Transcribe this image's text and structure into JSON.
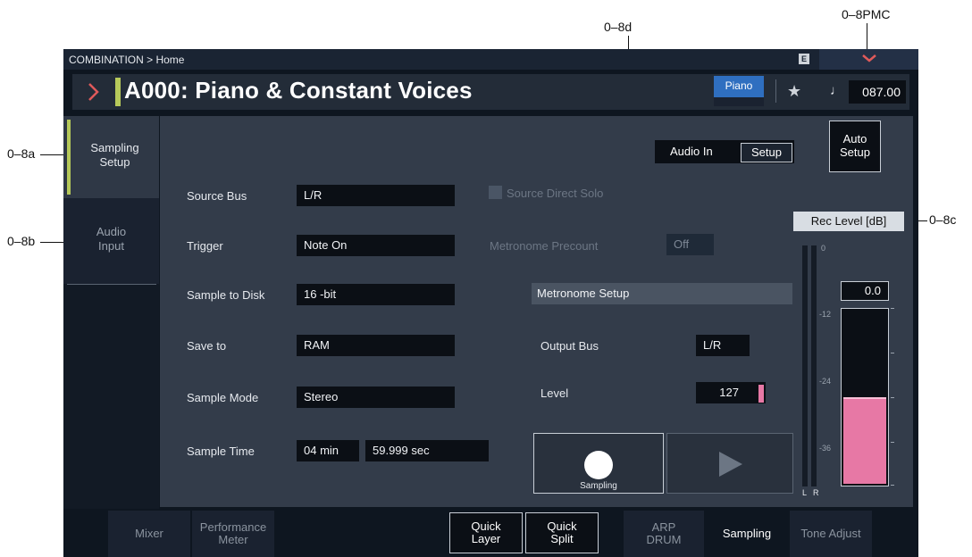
{
  "callouts": {
    "a": "0–8a",
    "b": "0–8b",
    "c": "0–8c",
    "d": "0–8d",
    "pmc": "0–8PMC"
  },
  "topbar": {
    "breadcrumb": "COMBINATION > Home",
    "badge": "E",
    "dropdown_icon": "chevron-down-icon"
  },
  "title": {
    "program_name": "A000: Piano & Constant Voices",
    "category": "Piano",
    "tempo": "087.00",
    "favorite_icon": "star-icon",
    "tempo_icon": "note-icon"
  },
  "side_tabs": {
    "sampling_setup": "Sampling Setup",
    "audio_input": "Audio Input"
  },
  "main": {
    "audio_in_label": "Audio In",
    "setup_button": "Setup",
    "auto_setup_button": "Auto Setup",
    "source_bus_label": "Source Bus",
    "source_bus_value": "L/R",
    "source_direct_solo_label": "Source Direct Solo",
    "trigger_label": "Trigger",
    "trigger_value": "Note On",
    "metronome_precount_label": "Metronome Precount",
    "metronome_precount_value": "Off",
    "sample_to_disk_label": "Sample to Disk",
    "sample_to_disk_value": "16 -bit",
    "metronome_setup_header": "Metronome Setup",
    "save_to_label": "Save to",
    "save_to_value": "RAM",
    "output_bus_label": "Output Bus",
    "output_bus_value": "L/R",
    "sample_mode_label": "Sample Mode",
    "sample_mode_value": "Stereo",
    "level_label": "Level",
    "level_value": "127",
    "sample_time_label": "Sample Time",
    "sample_time_min": "04 min",
    "sample_time_sec": "59.999 sec",
    "sampling_button": "Sampling"
  },
  "rec_level": {
    "header": "Rec Level [dB]",
    "value": "0.0",
    "scale": [
      "0",
      "-12",
      "-24",
      "-36"
    ],
    "fill_fraction": 0.86,
    "channels": [
      "L",
      "R"
    ],
    "fill_color": "#e778a5"
  },
  "bottom_tabs": {
    "mixer": "Mixer",
    "performance_meter": "Performance Meter",
    "quick_layer": "Quick Layer",
    "quick_split": "Quick Split",
    "arp_drum": "ARP DRUM",
    "sampling": "Sampling",
    "tone_adjust": "Tone Adjust"
  },
  "colors": {
    "accent": "#b6c95a",
    "category": "#2f6fc0",
    "meter_pink": "#e778a5",
    "chevron": "#e05a5a"
  }
}
